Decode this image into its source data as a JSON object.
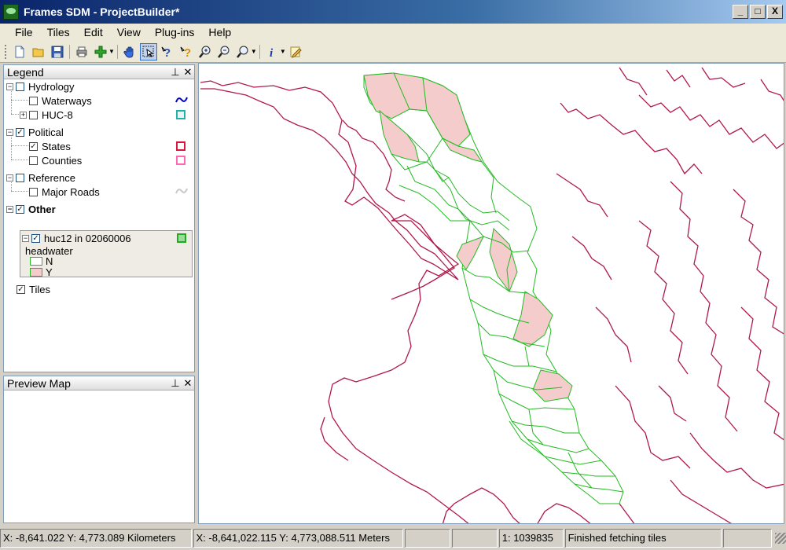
{
  "window": {
    "title": "Frames SDM  - ProjectBuilder*",
    "min": "_",
    "max": "□",
    "close": "X"
  },
  "menu": [
    "File",
    "Tiles",
    "Edit",
    "View",
    "Plug-ins",
    "Help"
  ],
  "toolbar": {
    "icons": [
      "new-icon",
      "open-icon",
      "save-icon",
      "print-icon",
      "add-layer-icon",
      "pan-icon",
      "select-icon",
      "help-icon",
      "query-icon",
      "zoom-in-icon",
      "zoom-out-icon",
      "zoom-icon",
      "info-icon",
      "edit-icon"
    ]
  },
  "legend": {
    "title": "Legend",
    "groups": [
      {
        "label": "Hydrology",
        "checked": false,
        "layers": [
          {
            "label": "Waterways",
            "checked": false,
            "symbol": "wave",
            "color": "#0000cc"
          },
          {
            "label": "HUC-8",
            "checked": false,
            "symbol": "square",
            "color": "#20b2aa"
          }
        ]
      },
      {
        "label": "Political",
        "checked": true,
        "layers": [
          {
            "label": "States",
            "checked": true,
            "symbol": "square",
            "color": "#dc143c"
          },
          {
            "label": "Counties",
            "checked": false,
            "symbol": "square",
            "color": "#ff69b4"
          }
        ]
      },
      {
        "label": "Reference",
        "checked": false,
        "layers": [
          {
            "label": "Major Roads",
            "checked": false,
            "symbol": "wave",
            "color": "#c0c0c0"
          }
        ]
      },
      {
        "label": "Other",
        "checked": true,
        "layers": [
          {
            "label": "huc12 in 02060006",
            "checked": true,
            "field": "headwater",
            "classes": [
              {
                "label": "N",
                "color": "#ffffff"
              },
              {
                "label": "Y",
                "color": "#f4cccc"
              }
            ]
          }
        ]
      }
    ],
    "tiles": {
      "label": "Tiles",
      "checked": true
    }
  },
  "preview": {
    "title": "Preview Map"
  },
  "status": {
    "coords_km": "X: -8,641.022 Y: 4,773.089 Kilometers",
    "coords_m": "X: -8,641,022.115 Y: 4,773,088.511 Meters",
    "scale": "1: 1039835",
    "message": "Finished fetching tiles"
  },
  "colors": {
    "watershed_outline": "#22bb22",
    "headwater_fill": "#f4cccc",
    "coastline": "#b0184c"
  }
}
